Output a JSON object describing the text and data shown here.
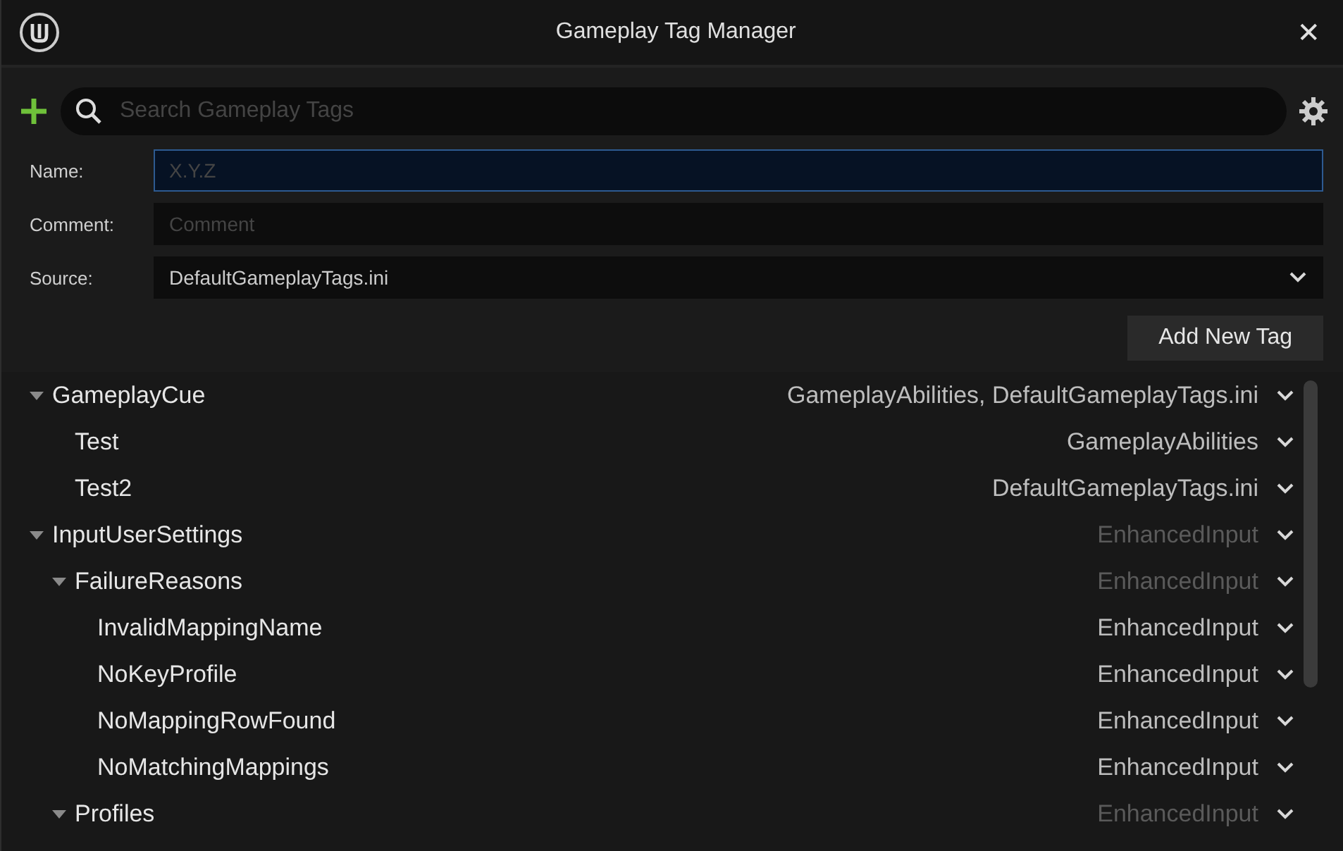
{
  "window": {
    "title": "Gameplay Tag Manager",
    "close": "✕"
  },
  "search": {
    "placeholder": "Search Gameplay Tags"
  },
  "form": [
    {
      "label": "Name:",
      "kind": "text",
      "placeholder": "X.Y.Z",
      "focused": true
    },
    {
      "label": "Comment:",
      "kind": "text",
      "placeholder": "Comment",
      "focused": false
    },
    {
      "label": "Source:",
      "kind": "dropdown",
      "value": "DefaultGameplayTags.ini",
      "focused": false
    }
  ],
  "add_button": "Add New Tag",
  "tree": [
    {
      "name": "GameplayCue",
      "source": "GameplayAbilities, DefaultGameplayTags.ini",
      "dimmed": false,
      "expanded": true,
      "children": [
        {
          "name": "Test",
          "source": "GameplayAbilities",
          "dimmed": false
        },
        {
          "name": "Test2",
          "source": "DefaultGameplayTags.ini",
          "dimmed": false
        }
      ]
    },
    {
      "name": "InputUserSettings",
      "source": "EnhancedInput",
      "dimmed": true,
      "expanded": true,
      "children": [
        {
          "name": "FailureReasons",
          "source": "EnhancedInput",
          "dimmed": true,
          "expanded": true,
          "children": [
            {
              "name": "InvalidMappingName",
              "source": "EnhancedInput",
              "dimmed": false
            },
            {
              "name": "NoKeyProfile",
              "source": "EnhancedInput",
              "dimmed": false
            },
            {
              "name": "NoMappingRowFound",
              "source": "EnhancedInput",
              "dimmed": false
            },
            {
              "name": "NoMatchingMappings",
              "source": "EnhancedInput",
              "dimmed": false
            }
          ]
        },
        {
          "name": "Profiles",
          "source": "EnhancedInput",
          "dimmed": true,
          "expanded": true
        }
      ]
    }
  ]
}
